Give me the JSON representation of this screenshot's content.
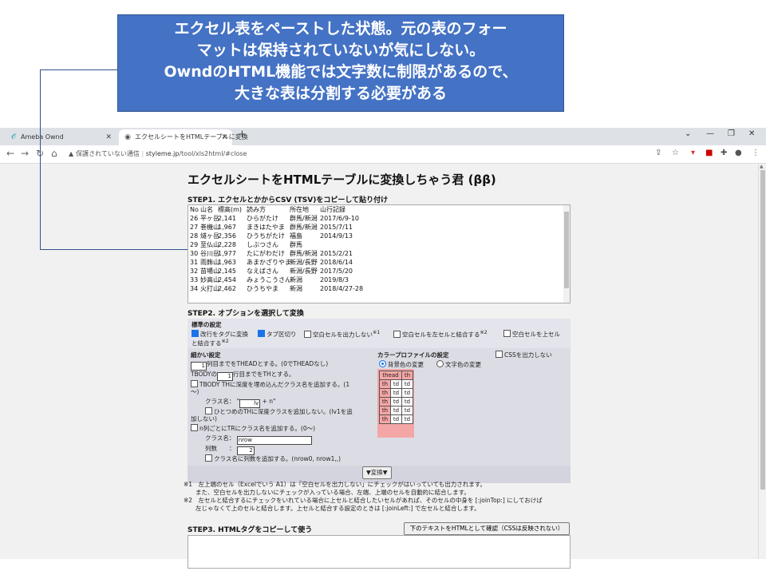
{
  "callout": {
    "line1": "エクセル表をペーストした状態。元の表のフォー",
    "line2": "マットは保持されていないが気にしない。",
    "line3": "OwndのHTML機能では文字数に制限があるので、",
    "line4": "大きな表は分割する必要がある"
  },
  "browser": {
    "tabs": [
      {
        "title": "Ameba Ownd"
      },
      {
        "title": "エクセルシートをHTMLテーブルに変換"
      }
    ],
    "security": "保護されていない通信",
    "url_host": "styleme.jp",
    "url_path": "/tool/xls2html/#close"
  },
  "page": {
    "title": "エクセルシートをHTMLテーブルに変換しちゃう君 (ββ)",
    "step1": "STEP1. エクセルとかからCSV (TSV)をコピーして貼り付け",
    "tsv_rows": [
      [
        "No",
        "山名",
        "標高(m)",
        "読み方",
        "所在地",
        "山行記録"
      ],
      [
        "26",
        "平ヶ岳",
        "2,141",
        "ひらがたけ",
        "群馬/新潟",
        "2017/6/9-10"
      ],
      [
        "27",
        "巻機山",
        "1,967",
        "まきはたやま",
        "群馬/新潟",
        "2015/7/11"
      ],
      [
        "28",
        "燧ヶ岳",
        "2,356",
        "ひうちがたけ",
        "福島",
        "2014/9/13"
      ],
      [
        "29",
        "至仏山",
        "2,228",
        "しぶつさん",
        "群馬",
        ""
      ],
      [
        "30",
        "谷川岳",
        "1,977",
        "たにがわだけ",
        "群馬/新潟",
        "2015/2/21"
      ],
      [
        "31",
        "雨飾山",
        "1,963",
        "あまかざりやま",
        "新潟/長野",
        "2018/6/14"
      ],
      [
        "32",
        "苗場山",
        "2,145",
        "なえばさん",
        "新潟/長野",
        "2017/5/20"
      ],
      [
        "33",
        "妙高山",
        "2,454",
        "みょうこうさん",
        "新潟",
        "2019/8/3"
      ],
      [
        "34",
        "火打山",
        "2,462",
        "ひうちやま",
        "新潟",
        "2018/4/27-28"
      ]
    ],
    "step2": "STEP2. オプションを選択して変換",
    "basic_title": "標準の設定",
    "basic_opts": {
      "o1": "改行をタグに変換",
      "o2": "タブ区切り",
      "o3": "空白セルを出力しない",
      "o3_note": "※1",
      "o4": "空白セルを左セルと結合する",
      "o4_note": "※2",
      "o5a": "空白セルを上セル",
      "o5b": "と結合する",
      "o5_note": "※2"
    },
    "detail_title": "細かい設定",
    "detail": {
      "thead_val": "1",
      "thead_text": "列目までをTHEADとする。(0でTHEADなし)",
      "tbody_pre": "TBODYの",
      "tbody_val": "1",
      "tbody_text": "行目までをTHとする。",
      "depth_text": "TBODY THに深度を埋め込んだクラス名を追加する。(1",
      "depth_text2": "〜)",
      "classname_label": "クラス名：",
      "classname_q1": "\"",
      "classname_val": "lv",
      "classname_q2": "+ n\"",
      "one_th_text": "ひとつめのTHに深度クラスを追加しない。(lv1を追",
      "one_th_text2": "加しない)",
      "ncol_text": "n列ごとにTRにクラス名を追加する。(0〜)",
      "ncol_class_label": "クラス名：",
      "ncol_class_val": "nrow",
      "ncol_count_label": "列数　　：",
      "ncol_count_val": "2",
      "ncol_add_text": "クラス名に列数を追加する。(nrow0, nrow1,,)"
    },
    "color_title": "カラープロファイルの設定",
    "no_css": "CSSを出力しない",
    "radio_bg": "背景色の変更",
    "radio_fg": "文字色の変更",
    "preview": {
      "head": [
        "thead",
        "th"
      ],
      "body_row": [
        "th",
        "td",
        "td"
      ]
    },
    "convert_button": "▼変換▼",
    "notes": {
      "n1": "※1　左上端のセル（Excelでいう A1）は「空白セルを出力しない」にチェックがはいっていても出力されます。",
      "n1b": "　　また、空白セルを出力しないにチェックが入っている場合、左端、上端のセルを自動的に結合します。",
      "n2": "※2　左セルと結合するにチェックをいれている場合に上セルと結合したいセルがあれば、そのセルの中身を [:joinTop:] にしておけば",
      "n2b": "　　左じゃなくて上のセルと結合します。上セルと結合する設定のときは [:joinLeft:] で左セルと結合します。"
    },
    "step3": "STEP3. HTMLタグをコピーして使う",
    "step3_button": "下のテキストをHTMLとして確認（CSSは反映されない）"
  }
}
